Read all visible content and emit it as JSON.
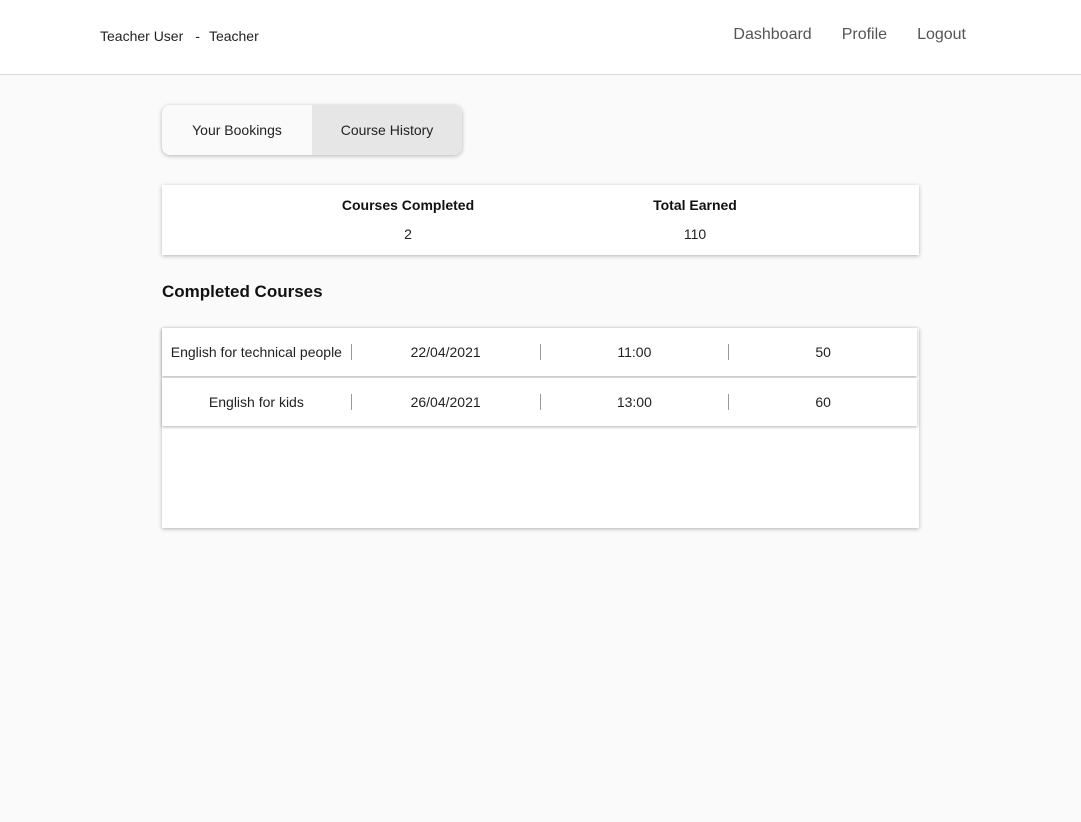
{
  "header": {
    "user_name": "Teacher User",
    "separator": "-",
    "role": "Teacher",
    "nav": [
      "Dashboard",
      "Profile",
      "Logout"
    ]
  },
  "tabs": {
    "items": [
      "Your Bookings",
      "Course History"
    ],
    "active": "Course History"
  },
  "stats": {
    "courses_completed_label": "Courses Completed",
    "courses_completed_value": "2",
    "total_earned_label": "Total Earned",
    "total_earned_value": "110"
  },
  "completed_courses": {
    "title": "Completed Courses",
    "rows": [
      {
        "name": "English for technical people",
        "date": "22/04/2021",
        "time": "11:00",
        "amount": "50"
      },
      {
        "name": "English for kids",
        "date": "26/04/2021",
        "time": "13:00",
        "amount": "60"
      }
    ]
  }
}
